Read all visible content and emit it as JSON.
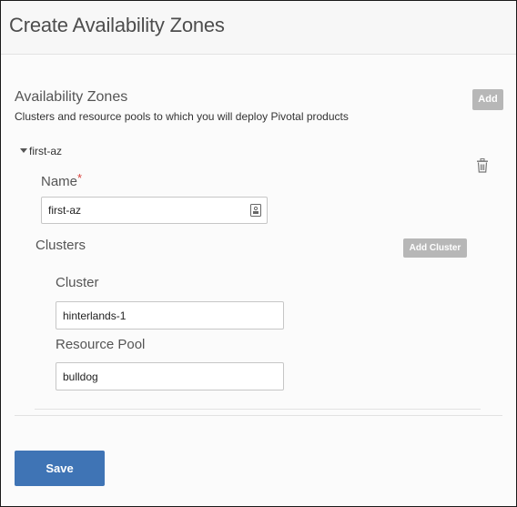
{
  "page": {
    "title": "Create Availability Zones"
  },
  "section": {
    "title": "Availability Zones",
    "subtitle": "Clusters and resource pools to which you will deploy Pivotal products",
    "add_label": "Add"
  },
  "az": {
    "name": "first-az",
    "name_label": "Name",
    "required_mark": "*",
    "name_value": "first-az",
    "clusters_label": "Clusters",
    "add_cluster_label": "Add Cluster",
    "cluster": {
      "cluster_label": "Cluster",
      "cluster_value": "hinterlands-1",
      "resource_pool_label": "Resource Pool",
      "resource_pool_value": "bulldog"
    }
  },
  "footer": {
    "save_label": "Save"
  },
  "icons": {
    "trash": "trash-icon",
    "caret": "caret-down-icon",
    "field_action": "lock-icon"
  },
  "colors": {
    "primary_button": "#3f74b5",
    "secondary_button": "#b7b7b7",
    "required": "#d9413b"
  }
}
